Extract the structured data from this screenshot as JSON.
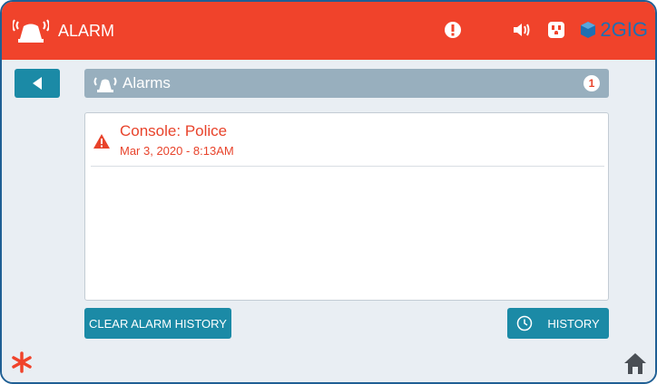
{
  "header": {
    "title": "ALARM",
    "brand": "2GIG",
    "status_icons": [
      "alert-icon",
      "moon-icon",
      "speaker-icon",
      "outlet-icon"
    ],
    "accent_color": "#f0432b"
  },
  "section": {
    "title": "Alarms",
    "count": "1"
  },
  "alarms": [
    {
      "title": "Console: Police",
      "time": "Mar 3, 2020 - 8:13AM"
    }
  ],
  "buttons": {
    "clear_history": "CLEAR ALARM HISTORY",
    "history": "HISTORY"
  },
  "colors": {
    "primary_button": "#1b8aa6",
    "section_header": "#98afbe",
    "alarm_text": "#e8432b",
    "brand": "#1f6fb2"
  }
}
